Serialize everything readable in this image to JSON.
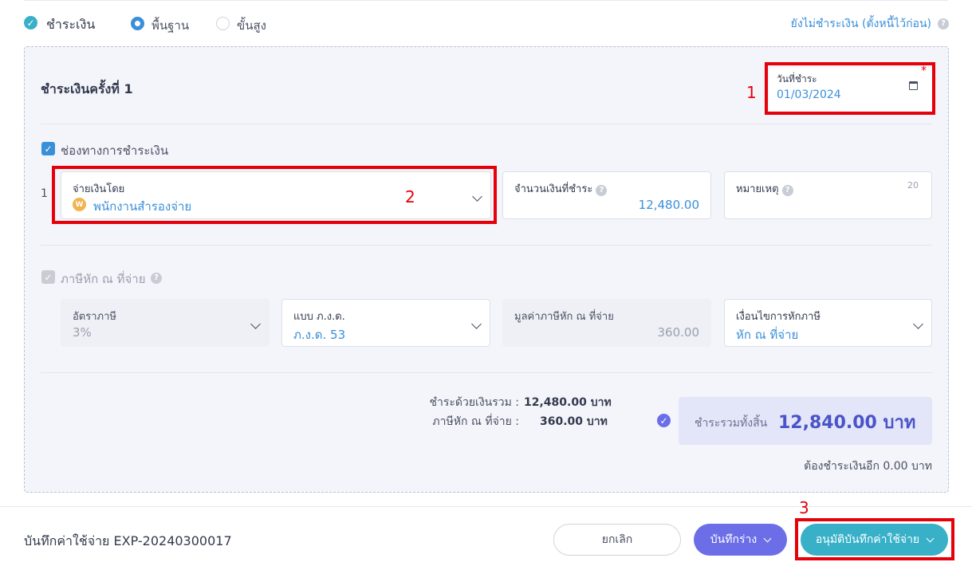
{
  "payment_toggle": {
    "label": "ชำระเงิน",
    "mode_basic": "พื้นฐาน",
    "mode_advanced": "ขั้นสูง",
    "unpaid_link": "ยังไม่ชำระเงิน (ตั้งหนี้ไว้ก่อน)"
  },
  "payment_round": {
    "title": "ชำระเงินครั้งที่ 1",
    "date_label": "วันที่ชำระ",
    "date_value": "01/03/2024",
    "required_mark": "*"
  },
  "channels": {
    "label": "ช่องทางการชำระเงิน",
    "row_index": "1",
    "paid_by_label": "จ่ายเงินโดย",
    "paid_by_badge": "W",
    "paid_by_value": "พนักงานสำรองจ่าย",
    "amount_label": "จำนวนเงินที่ชำระ",
    "amount_value": "12,480.00",
    "note_label": "หมายเหตุ",
    "note_counter": "20"
  },
  "withholding": {
    "label": "ภาษีหัก ณ ที่จ่าย",
    "rate_label": "อัตราภาษี",
    "rate_value": "3%",
    "form_label": "แบบ ภ.ง.ด.",
    "form_value": "ภ.ง.ด. 53",
    "amount_label": "มูลค่าภาษีหัก ณ ที่จ่าย",
    "amount_value": "360.00",
    "condition_label": "เงื่อนไขการหักภาษี",
    "condition_value": "หัก ณ ที่จ่าย"
  },
  "summary": {
    "paid_total_label": "ชำระด้วยเงินรวม :",
    "paid_total_value": "12,480.00 บาท",
    "wht_label": "ภาษีหัก ณ ที่จ่าย :",
    "wht_value": "360.00 บาท",
    "grand_label": "ชำระรวมทั้งสิ้น",
    "grand_value": "12,840.00 บาท",
    "remaining": "ต้องชำระเงินอีก 0.00 บาท"
  },
  "annotations": {
    "n1": "1",
    "n2": "2",
    "n3": "3"
  },
  "footer": {
    "doc_title": "บันทึกค่าใช้จ่าย EXP-20240300017",
    "cancel": "ยกเลิก",
    "save_draft": "บันทึกร่าง",
    "approve": "อนุมัติบันทึกค่าใช้จ่าย"
  },
  "colors": {
    "primary": "#3a8fd9",
    "teal": "#37b0c8",
    "purple": "#6c6ee8",
    "annotation_red": "#e5000a"
  }
}
